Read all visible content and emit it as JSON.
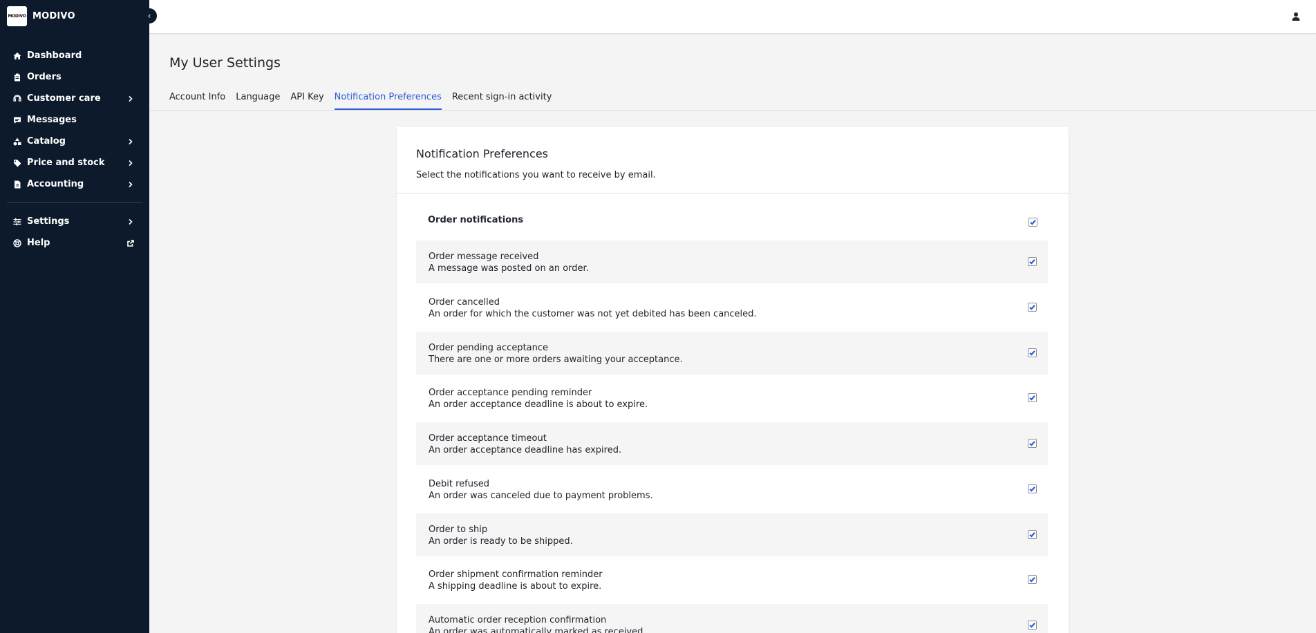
{
  "brand": {
    "logo_text": "MODIVO",
    "name": "MODIVO"
  },
  "sidebar": {
    "items": [
      {
        "label": "Dashboard",
        "icon": "home-icon",
        "has_chevron": false
      },
      {
        "label": "Orders",
        "icon": "clipboard-icon",
        "has_chevron": false
      },
      {
        "label": "Customer care",
        "icon": "headset-icon",
        "has_chevron": true
      },
      {
        "label": "Messages",
        "icon": "chat-icon",
        "has_chevron": false
      },
      {
        "label": "Catalog",
        "icon": "shapes-icon",
        "has_chevron": true
      },
      {
        "label": "Price and stock",
        "icon": "tag-icon",
        "has_chevron": true
      },
      {
        "label": "Accounting",
        "icon": "invoice-icon",
        "has_chevron": true
      }
    ],
    "bottom_items": [
      {
        "label": "Settings",
        "icon": "sliders-icon",
        "has_chevron": true
      },
      {
        "label": "Help",
        "icon": "lifebuoy-icon",
        "external": true
      }
    ]
  },
  "page": {
    "title": "My User Settings"
  },
  "tabs": [
    {
      "label": "Account Info",
      "active": false
    },
    {
      "label": "Language",
      "active": false
    },
    {
      "label": "API Key",
      "active": false
    },
    {
      "label": "Notification Preferences",
      "active": true
    },
    {
      "label": "Recent sign-in activity",
      "active": false
    }
  ],
  "card": {
    "title": "Notification Preferences",
    "subtitle": "Select the notifications you want to receive by email.",
    "group": {
      "title": "Order notifications",
      "checked": true
    },
    "notifications": [
      {
        "title": "Order message received",
        "description": "A message was posted on an order.",
        "checked": true
      },
      {
        "title": "Order cancelled",
        "description": "An order for which the customer was not yet debited has been canceled.",
        "checked": true
      },
      {
        "title": "Order pending acceptance",
        "description": "There are one or more orders awaiting your acceptance.",
        "checked": true
      },
      {
        "title": "Order acceptance pending reminder",
        "description": "An order acceptance deadline is about to expire.",
        "checked": true
      },
      {
        "title": "Order acceptance timeout",
        "description": "An order acceptance deadline has expired.",
        "checked": true
      },
      {
        "title": "Debit refused",
        "description": "An order was canceled due to payment problems.",
        "checked": true
      },
      {
        "title": "Order to ship",
        "description": "An order is ready to be shipped.",
        "checked": true
      },
      {
        "title": "Order shipment confirmation reminder",
        "description": "A shipping deadline is about to expire.",
        "checked": true
      },
      {
        "title": "Automatic order reception confirmation",
        "description": "An order was automatically marked as received.",
        "checked": true
      }
    ]
  },
  "colors": {
    "sidebar_bg": "#0d1a2b",
    "accent": "#2a5bd7",
    "page_bg": "#f4f4f4"
  }
}
